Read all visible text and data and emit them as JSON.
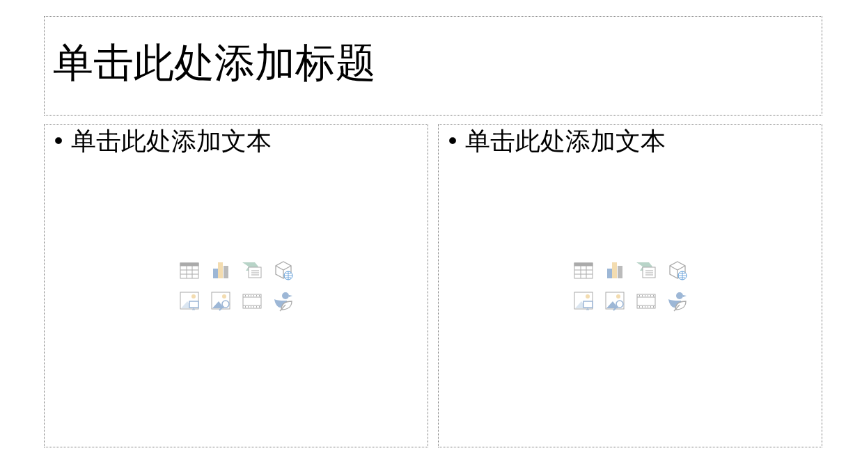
{
  "title_placeholder": {
    "text": "单击此处添加标题"
  },
  "content_placeholders": [
    {
      "bullet": "•",
      "text": "单击此处添加文本"
    },
    {
      "bullet": "•",
      "text": "单击此处添加文本"
    }
  ]
}
